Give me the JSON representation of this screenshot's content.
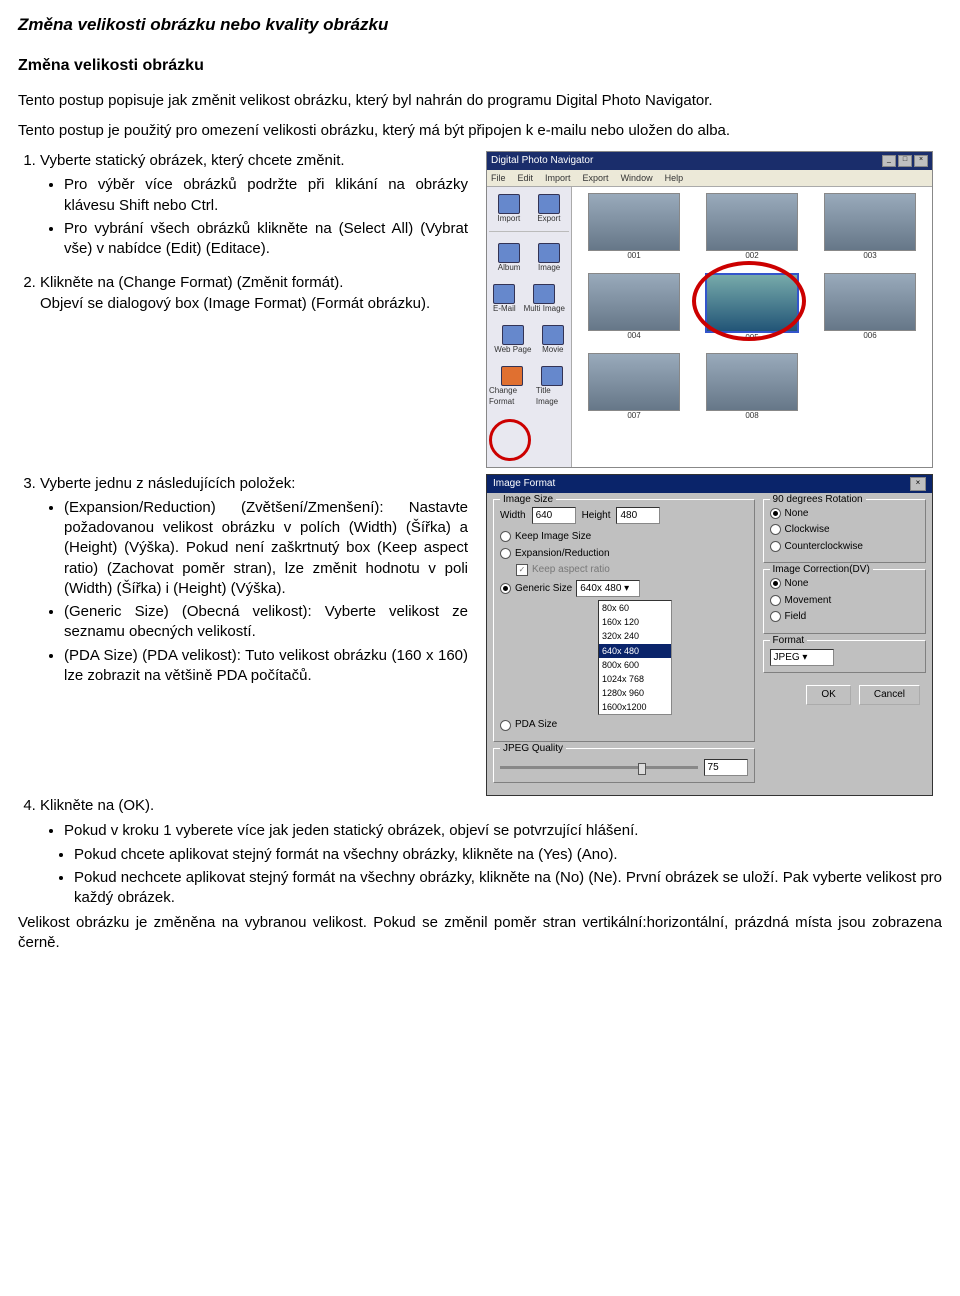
{
  "title": "Změna velikosti obrázku nebo kvality obrázku",
  "subtitle": "Změna velikosti obrázku",
  "intro1": "Tento postup popisuje jak změnit velikost obrázku, který byl nahrán do programu Digital Photo Navigator.",
  "intro2": "Tento postup je použitý pro omezení velikosti obrázku, který má být připojen k e-mailu nebo uložen do alba.",
  "step1": {
    "text": "Vyberte statický obrázek, který chcete změnit.",
    "bullets": [
      "Pro výběr více obrázků podržte při klikání na obrázky klávesu Shift nebo Ctrl.",
      "Pro vybrání všech obrázků klikněte na (Select All) (Vybrat vše) v nabídce (Edit) (Editace)."
    ]
  },
  "step2": {
    "text": "Klikněte na (Change Format) (Změnit formát).",
    "after": "Objeví se dialogový box (Image Format) (Formát obrázku)."
  },
  "step3": {
    "text": "Vyberte jednu z následujících položek:",
    "bullets": [
      "(Expansion/Reduction) (Zvětšení/Zmenšení): Nastavte požadovanou velikost obrázku v polích (Width) (Šířka) a (Height) (Výška). Pokud není zaškrtnutý box (Keep aspect ratio) (Zachovat poměr stran), lze změnit hodnotu v poli (Width) (Šířka) i (Height) (Výška).",
      "(Generic Size) (Obecná velikost): Vyberte velikost ze seznamu obecných velikostí.",
      "(PDA Size) (PDA velikost): Tuto velikost obrázku (160 x 160) lze zobrazit na většině PDA počítačů."
    ]
  },
  "step4": {
    "text": "Klikněte na (OK).",
    "bullets": [
      "Pokud v kroku 1 vyberete více jak jeden statický obrázek, objeví se potvrzující hlášení."
    ],
    "sub_bullets": [
      "Pokud chcete aplikovat stejný formát na všechny obrázky, klikněte na (Yes) (Ano).",
      "Pokud nechcete aplikovat stejný formát na všechny obrázky, klikněte na (No) (Ne). První obrázek se uloží. Pak vyberte velikost pro každý obrázek."
    ],
    "closing": "Velikost obrázku je změněna na vybranou velikost. Pokud se změnil poměr stran vertikální:horizontální, prázdná místa jsou zobrazena černě."
  },
  "app": {
    "title": "Digital Photo Navigator",
    "menu": [
      "File",
      "Edit",
      "Import",
      "Export",
      "Window",
      "Help"
    ],
    "top_icons": [
      "Import",
      "Export"
    ],
    "side_icons": [
      "Album",
      "Image",
      "E-Mail",
      "Multi Image",
      "Web Page",
      "Movie",
      "Change Format",
      "Title Image"
    ],
    "thumbs": [
      "001",
      "002",
      "003",
      "004",
      "005",
      "006",
      "007",
      "008"
    ]
  },
  "dialog": {
    "title": "Image Format",
    "image_size": "Image Size",
    "width_label": "Width",
    "width_val": "640",
    "height_label": "Height",
    "height_val": "480",
    "opts": {
      "keep": "Keep Image Size",
      "expand": "Expansion/Reduction",
      "aspect": "Keep aspect ratio",
      "generic": "Generic Size",
      "pda": "PDA Size"
    },
    "sizes": [
      "80x 60",
      "160x 120",
      "320x 240",
      "640x 480",
      "800x 600",
      "1024x 768",
      "1280x 960",
      "1600x1200"
    ],
    "jpeg": "JPEG Quality",
    "jpeg_val": "75",
    "rotation": {
      "title": "90 degrees Rotation",
      "none": "None",
      "cw": "Clockwise",
      "ccw": "Counterclockwise"
    },
    "correction": {
      "title": "Image Correction(DV)",
      "none": "None",
      "movement": "Movement",
      "field": "Field"
    },
    "format_title": "Format",
    "format_val": "JPEG",
    "ok": "OK",
    "cancel": "Cancel"
  }
}
